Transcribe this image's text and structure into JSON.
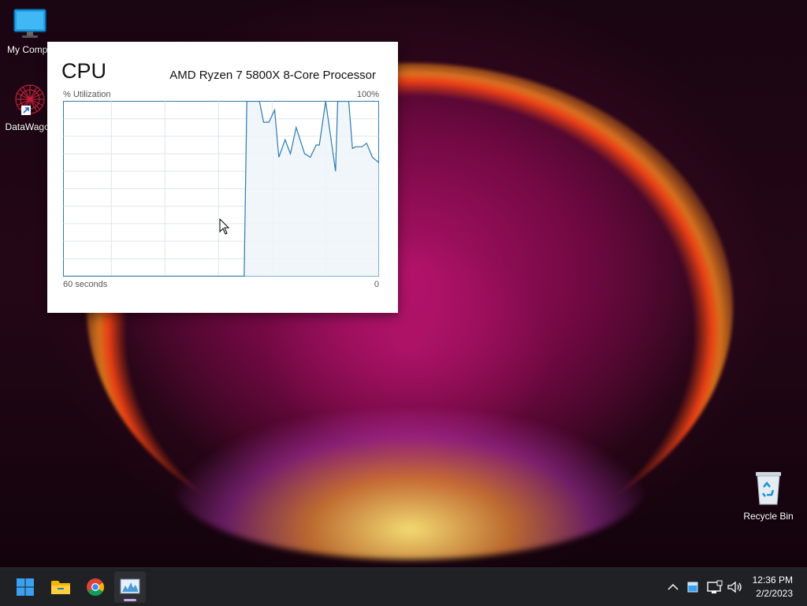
{
  "desktop": {
    "icons": [
      {
        "label": "My Compu",
        "icon": "monitor-icon"
      },
      {
        "label": "DataWagon",
        "icon": "datawagon-app-icon"
      },
      {
        "label": "Recycle Bin",
        "icon": "recycle-bin-icon"
      }
    ]
  },
  "cpu_widget": {
    "title": "CPU",
    "processor": "AMD Ryzen 7 5800X 8-Core Processor",
    "y_label": "% Utilization",
    "y_max_label": "100%",
    "x_left_label": "60 seconds",
    "x_right_label": "0",
    "colors": {
      "line": "#2a7bb0",
      "fill": "#eef4fa",
      "grid": "#dde6ee"
    }
  },
  "chart_data": {
    "type": "area",
    "xlabel": "60 seconds",
    "ylabel": "% Utilization",
    "ylim": [
      0,
      100
    ],
    "xlim": [
      60,
      0
    ],
    "grid": true,
    "series": [
      {
        "values_x": [
          60,
          25.6,
          25.1,
          23.4,
          22.7,
          21.9,
          20.9,
          19.8,
          19.0,
          17.8,
          16.8,
          15.7,
          14.1,
          13.0,
          11.9,
          11.3,
          10.1,
          8.2,
          7.8,
          6.8,
          6.6,
          5.7,
          5.0,
          4.4,
          3.2,
          2.3,
          1.2,
          0.0
        ],
        "values_y": [
          0,
          0,
          100,
          100,
          100,
          88,
          88,
          95,
          68,
          78,
          70,
          85,
          70,
          68,
          75,
          75,
          100,
          60,
          100,
          100,
          100,
          100,
          73,
          74,
          74,
          76,
          68,
          65
        ]
      }
    ]
  },
  "taskbar": {
    "apps": [
      "start-icon",
      "file-explorer-icon",
      "chrome-icon",
      "task-manager-icon"
    ],
    "clock_time": "12:36 PM",
    "clock_date": "2/2/2023"
  }
}
